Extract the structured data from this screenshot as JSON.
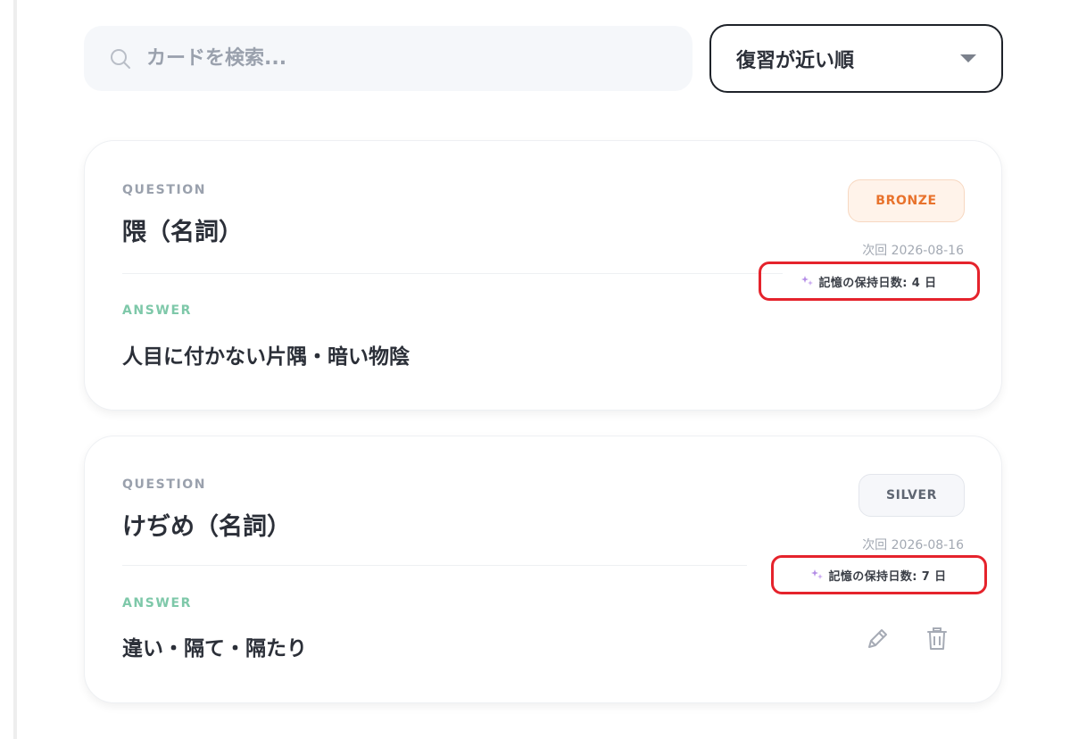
{
  "search": {
    "placeholder": "カードを検索..."
  },
  "sort": {
    "selected": "復習が近い順"
  },
  "colors": {
    "bronze": "#e8722c",
    "silver": "#5f6672",
    "answer_label": "#7ec8a9",
    "highlight": "#e5232c"
  },
  "cards": [
    {
      "question_label": "QUESTION",
      "question": "隈（名詞）",
      "answer_label": "ANSWER",
      "answer": "人目に付かない片隅・暗い物陰",
      "tier": "BRONZE",
      "next_review": "次回 2026-08-16",
      "retention": "記憶の保持日数: 4 日"
    },
    {
      "question_label": "QUESTION",
      "question": "けぢめ（名詞）",
      "answer_label": "ANSWER",
      "answer": "違い・隔て・隔たり",
      "tier": "SILVER",
      "next_review": "次回 2026-08-16",
      "retention": "記憶の保持日数: 7 日"
    }
  ]
}
